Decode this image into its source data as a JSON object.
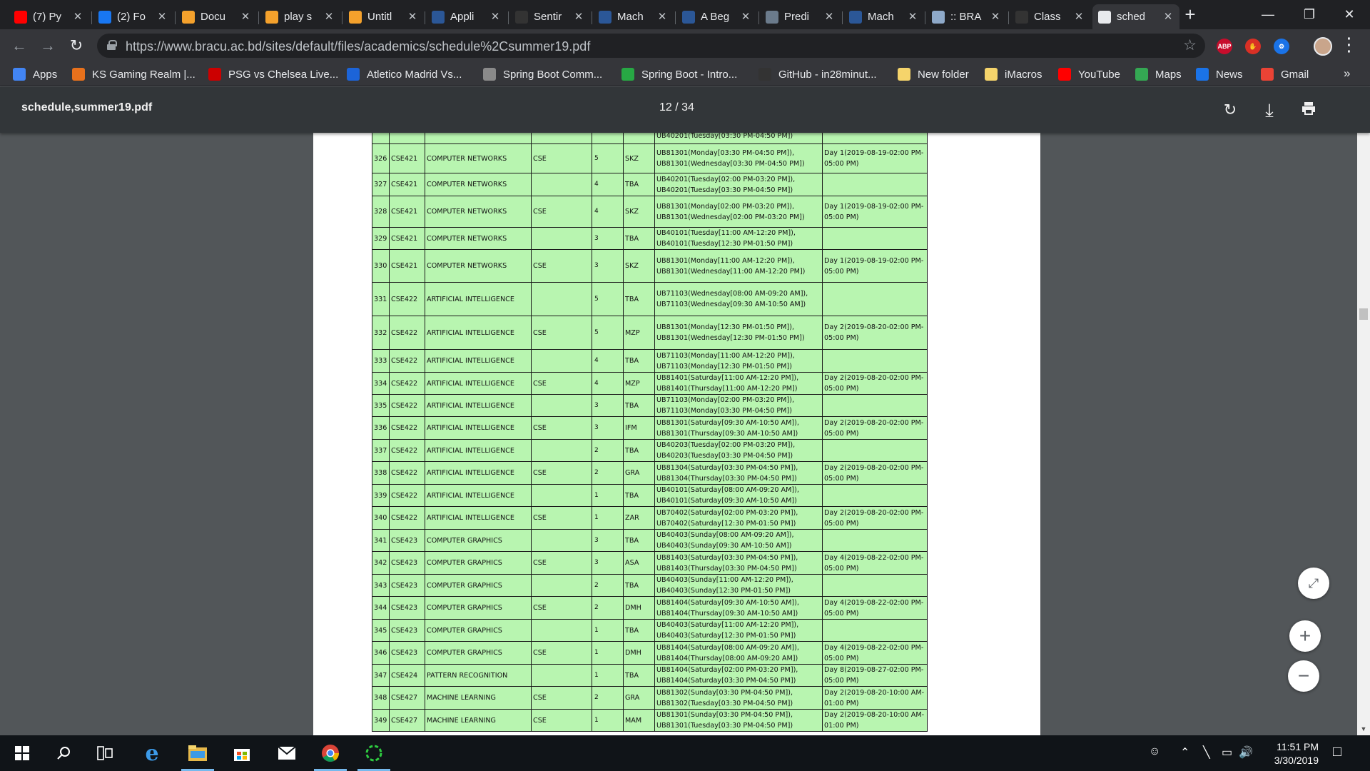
{
  "browser": {
    "tabs": [
      {
        "title": "(7) Py",
        "icon": "youtube-icon",
        "color": "#ff0000"
      },
      {
        "title": "(2) Fo",
        "icon": "facebook-icon",
        "color": "#1877f2"
      },
      {
        "title": "Docu",
        "icon": "docs-icon",
        "color": "#f4a12c"
      },
      {
        "title": "play s",
        "icon": "notebook-icon",
        "color": "#f4a12c"
      },
      {
        "title": "Untitl",
        "icon": "notebook-icon",
        "color": "#f4a12c"
      },
      {
        "title": "Appli",
        "icon": "page-icon",
        "color": "#2b5797"
      },
      {
        "title": "Sentir",
        "icon": "github-icon",
        "color": "#333333"
      },
      {
        "title": "Mach",
        "icon": "page-icon",
        "color": "#2b5797"
      },
      {
        "title": "A Beg",
        "icon": "page-icon",
        "color": "#2b5797"
      },
      {
        "title": "Predi",
        "icon": "image-icon",
        "color": "#6b7b8c"
      },
      {
        "title": "Mach",
        "icon": "page-icon",
        "color": "#2b5797"
      },
      {
        "title": ":: BRA",
        "icon": "bracu-icon",
        "color": "#8ea9c9"
      },
      {
        "title": "Class",
        "icon": "github-icon",
        "color": "#333333"
      },
      {
        "title": "sched",
        "icon": "document-icon",
        "color": "#e8eaed"
      }
    ],
    "url": "https://www.bracu.ac.bd/sites/default/files/academics/schedule%2Csummer19.pdf",
    "extensions": [
      {
        "label": "ABP",
        "icon": "adblock-icon",
        "color": "#c70d2c"
      },
      {
        "label": "✋",
        "icon": "hand-icon",
        "color": "#d93025"
      },
      {
        "label": "⚙",
        "icon": "settings-extension-icon",
        "color": "#1a73e8"
      }
    ],
    "bookmarks": [
      {
        "label": "Apps",
        "icon": "apps-grid-icon",
        "color": "#4285f4"
      },
      {
        "label": "KS Gaming Realm |...",
        "icon": "ks-gaming-icon",
        "color": "#e8711c"
      },
      {
        "label": "PSG vs Chelsea Live...",
        "icon": "ts-icon",
        "color": "#cc0000"
      },
      {
        "label": "Atletico Madrid Vs...",
        "icon": "soccer-icon",
        "color": "#1c64d8"
      },
      {
        "label": "Spring Boot Comm...",
        "icon": "spring-icon",
        "color": "#8a8a8a"
      },
      {
        "label": "Spring Boot - Intro...",
        "icon": "tutorial-icon",
        "color": "#27a844"
      },
      {
        "label": "GitHub - in28minut...",
        "icon": "github-icon",
        "color": "#333333"
      },
      {
        "label": "New folder",
        "icon": "folder-icon",
        "color": "#f5d46b"
      },
      {
        "label": "iMacros",
        "icon": "folder-icon",
        "color": "#f5d46b"
      },
      {
        "label": "YouTube",
        "icon": "youtube-icon",
        "color": "#ff0000"
      },
      {
        "label": "Maps",
        "icon": "maps-icon",
        "color": "#34a853"
      },
      {
        "label": "News",
        "icon": "news-icon",
        "color": "#1a73e8"
      },
      {
        "label": "Gmail",
        "icon": "gmail-icon",
        "color": "#ea4335"
      }
    ],
    "more_bookmarks": "»"
  },
  "pdf": {
    "filename": "schedule,summer19.pdf",
    "page_indicator": "12 / 34",
    "rows": [
      {
        "no": "",
        "code": "",
        "course": "",
        "dept": "",
        "sec": "",
        "faculty": "",
        "class_lines": [
          "",
          "UB40201(Tuesday[03:30 PM-04:50 PM])"
        ],
        "exam_lines": [
          ""
        ]
      },
      {
        "no": "326",
        "code": "CSE421",
        "course": "COMPUTER NETWORKS",
        "dept": "CSE",
        "sec": "5",
        "faculty": "SKZ",
        "class_lines": [
          "UB81301(Monday[03:30 PM-04:50 PM]),",
          "UB81301(Wednesday[03:30 PM-04:50 PM])"
        ],
        "exam_lines": [
          "Day 1(2019-08-19-02:00 PM-",
          "05:00 PM)"
        ]
      },
      {
        "no": "327",
        "code": "CSE421",
        "course": "COMPUTER NETWORKS",
        "dept": "",
        "sec": "4",
        "faculty": "TBA",
        "class_lines": [
          "UB40201(Tuesday[02:00 PM-03:20 PM]),",
          "UB40201(Tuesday[03:30 PM-04:50 PM])"
        ],
        "exam_lines": [
          ""
        ]
      },
      {
        "no": "328",
        "code": "CSE421",
        "course": "COMPUTER NETWORKS",
        "dept": "CSE",
        "sec": "4",
        "faculty": "SKZ",
        "class_lines": [
          "UB81301(Monday[02:00 PM-03:20 PM]),",
          "UB81301(Wednesday[02:00 PM-03:20 PM])"
        ],
        "exam_lines": [
          "Day 1(2019-08-19-02:00 PM-",
          "05:00 PM)"
        ]
      },
      {
        "no": "329",
        "code": "CSE421",
        "course": "COMPUTER NETWORKS",
        "dept": "",
        "sec": "3",
        "faculty": "TBA",
        "class_lines": [
          "UB40101(Tuesday[11:00 AM-12:20 PM]),",
          "UB40101(Tuesday[12:30 PM-01:50 PM])"
        ],
        "exam_lines": [
          ""
        ]
      },
      {
        "no": "330",
        "code": "CSE421",
        "course": "COMPUTER NETWORKS",
        "dept": "CSE",
        "sec": "3",
        "faculty": "SKZ",
        "class_lines": [
          "UB81301(Monday[11:00 AM-12:20 PM]),",
          "UB81301(Wednesday[11:00 AM-12:20 PM])"
        ],
        "exam_lines": [
          "Day 1(2019-08-19-02:00 PM-",
          "05:00 PM)"
        ]
      },
      {
        "no": "331",
        "code": "CSE422",
        "course": "ARTIFICIAL INTELLIGENCE",
        "dept": "",
        "sec": "5",
        "faculty": "TBA",
        "class_lines": [
          "UB71103(Wednesday[08:00 AM-09:20 AM]),",
          "UB71103(Wednesday[09:30 AM-10:50 AM])"
        ],
        "exam_lines": [
          ""
        ]
      },
      {
        "no": "332",
        "code": "CSE422",
        "course": "ARTIFICIAL INTELLIGENCE",
        "dept": "CSE",
        "sec": "5",
        "faculty": "MZP",
        "class_lines": [
          "UB81301(Monday[12:30 PM-01:50 PM]),",
          "UB81301(Wednesday[12:30 PM-01:50 PM])"
        ],
        "exam_lines": [
          "Day 2(2019-08-20-02:00 PM-",
          "05:00 PM)"
        ]
      },
      {
        "no": "333",
        "code": "CSE422",
        "course": "ARTIFICIAL INTELLIGENCE",
        "dept": "",
        "sec": "4",
        "faculty": "TBA",
        "class_lines": [
          "UB71103(Monday[11:00 AM-12:20 PM]),",
          "UB71103(Monday[12:30 PM-01:50 PM])"
        ],
        "exam_lines": [
          ""
        ]
      },
      {
        "no": "334",
        "code": "CSE422",
        "course": "ARTIFICIAL INTELLIGENCE",
        "dept": "CSE",
        "sec": "4",
        "faculty": "MZP",
        "class_lines": [
          "UB81401(Saturday[11:00 AM-12:20 PM]),",
          "UB81401(Thursday[11:00 AM-12:20 PM])"
        ],
        "exam_lines": [
          "Day 2(2019-08-20-02:00 PM-",
          "05:00 PM)"
        ]
      },
      {
        "no": "335",
        "code": "CSE422",
        "course": "ARTIFICIAL INTELLIGENCE",
        "dept": "",
        "sec": "3",
        "faculty": "TBA",
        "class_lines": [
          "UB71103(Monday[02:00 PM-03:20 PM]),",
          "UB71103(Monday[03:30 PM-04:50 PM])"
        ],
        "exam_lines": [
          ""
        ]
      },
      {
        "no": "336",
        "code": "CSE422",
        "course": "ARTIFICIAL INTELLIGENCE",
        "dept": "CSE",
        "sec": "3",
        "faculty": "IFM",
        "class_lines": [
          "UB81301(Saturday[09:30 AM-10:50 AM]),",
          "UB81301(Thursday[09:30 AM-10:50 AM])"
        ],
        "exam_lines": [
          "Day 2(2019-08-20-02:00 PM-",
          "05:00 PM)"
        ]
      },
      {
        "no": "337",
        "code": "CSE422",
        "course": "ARTIFICIAL INTELLIGENCE",
        "dept": "",
        "sec": "2",
        "faculty": "TBA",
        "class_lines": [
          "UB40203(Tuesday[02:00 PM-03:20 PM]),",
          "UB40203(Tuesday[03:30 PM-04:50 PM])"
        ],
        "exam_lines": [
          ""
        ]
      },
      {
        "no": "338",
        "code": "CSE422",
        "course": "ARTIFICIAL INTELLIGENCE",
        "dept": "CSE",
        "sec": "2",
        "faculty": "GRA",
        "class_lines": [
          "UB81304(Saturday[03:30 PM-04:50 PM]),",
          "UB81304(Thursday[03:30 PM-04:50 PM])"
        ],
        "exam_lines": [
          "Day 2(2019-08-20-02:00 PM-",
          "05:00 PM)"
        ]
      },
      {
        "no": "339",
        "code": "CSE422",
        "course": "ARTIFICIAL INTELLIGENCE",
        "dept": "",
        "sec": "1",
        "faculty": "TBA",
        "class_lines": [
          "UB40101(Saturday[08:00 AM-09:20 AM]),",
          "UB40101(Saturday[09:30 AM-10:50 AM])"
        ],
        "exam_lines": [
          ""
        ]
      },
      {
        "no": "340",
        "code": "CSE422",
        "course": "ARTIFICIAL INTELLIGENCE",
        "dept": "CSE",
        "sec": "1",
        "faculty": "ZAR",
        "class_lines": [
          "UB70402(Saturday[02:00 PM-03:20 PM]),",
          "UB70402(Saturday[12:30 PM-01:50 PM])"
        ],
        "exam_lines": [
          "Day 2(2019-08-20-02:00 PM-",
          "05:00 PM)"
        ]
      },
      {
        "no": "341",
        "code": "CSE423",
        "course": "COMPUTER GRAPHICS",
        "dept": "",
        "sec": "3",
        "faculty": "TBA",
        "class_lines": [
          "UB40403(Sunday[08:00 AM-09:20 AM]),",
          "UB40403(Sunday[09:30 AM-10:50 AM])"
        ],
        "exam_lines": [
          ""
        ]
      },
      {
        "no": "342",
        "code": "CSE423",
        "course": "COMPUTER GRAPHICS",
        "dept": "CSE",
        "sec": "3",
        "faculty": "ASA",
        "class_lines": [
          "UB81403(Saturday[03:30 PM-04:50 PM]),",
          "UB81403(Thursday[03:30 PM-04:50 PM])"
        ],
        "exam_lines": [
          "Day 4(2019-08-22-02:00 PM-",
          "05:00 PM)"
        ]
      },
      {
        "no": "343",
        "code": "CSE423",
        "course": "COMPUTER GRAPHICS",
        "dept": "",
        "sec": "2",
        "faculty": "TBA",
        "class_lines": [
          "UB40403(Sunday[11:00 AM-12:20 PM]),",
          "UB40403(Sunday[12:30 PM-01:50 PM])"
        ],
        "exam_lines": [
          ""
        ]
      },
      {
        "no": "344",
        "code": "CSE423",
        "course": "COMPUTER GRAPHICS",
        "dept": "CSE",
        "sec": "2",
        "faculty": "DMH",
        "class_lines": [
          "UB81404(Saturday[09:30 AM-10:50 AM]),",
          "UB81404(Thursday[09:30 AM-10:50 AM])"
        ],
        "exam_lines": [
          "Day 4(2019-08-22-02:00 PM-",
          "05:00 PM)"
        ]
      },
      {
        "no": "345",
        "code": "CSE423",
        "course": "COMPUTER GRAPHICS",
        "dept": "",
        "sec": "1",
        "faculty": "TBA",
        "class_lines": [
          "UB40403(Saturday[11:00 AM-12:20 PM]),",
          "UB40403(Saturday[12:30 PM-01:50 PM])"
        ],
        "exam_lines": [
          ""
        ]
      },
      {
        "no": "346",
        "code": "CSE423",
        "course": "COMPUTER GRAPHICS",
        "dept": "CSE",
        "sec": "1",
        "faculty": "DMH",
        "class_lines": [
          "UB81404(Saturday[08:00 AM-09:20 AM]),",
          "UB81404(Thursday[08:00 AM-09:20 AM])"
        ],
        "exam_lines": [
          "Day 4(2019-08-22-02:00 PM-",
          "05:00 PM)"
        ]
      },
      {
        "no": "347",
        "code": "CSE424",
        "course": "PATTERN RECOGNITION",
        "dept": "",
        "sec": "1",
        "faculty": "TBA",
        "class_lines": [
          "UB81404(Saturday[02:00 PM-03:20 PM]),",
          "UB81404(Saturday[03:30 PM-04:50 PM])"
        ],
        "exam_lines": [
          "Day 8(2019-08-27-02:00 PM-",
          "05:00 PM)"
        ]
      },
      {
        "no": "348",
        "code": "CSE427",
        "course": "MACHINE LEARNING",
        "dept": "CSE",
        "sec": "2",
        "faculty": "GRA",
        "class_lines": [
          "UB81302(Sunday[03:30 PM-04:50 PM]),",
          "UB81302(Tuesday[03:30 PM-04:50 PM])"
        ],
        "exam_lines": [
          "Day 2(2019-08-20-10:00 AM-",
          "01:00 PM)"
        ]
      },
      {
        "no": "349",
        "code": "CSE427",
        "course": "MACHINE LEARNING",
        "dept": "CSE",
        "sec": "1",
        "faculty": "MAM",
        "class_lines": [
          "UB81301(Sunday[03:30 PM-04:50 PM]),",
          "UB81301(Tuesday[03:30 PM-04:50 PM])"
        ],
        "exam_lines": [
          "Day 2(2019-08-20-10:00 AM-",
          "01:00 PM)"
        ]
      }
    ],
    "row_color": "#b8f5b0"
  },
  "taskbar": {
    "apps": [
      {
        "icon": "windows-start-icon",
        "running": false
      },
      {
        "icon": "search-icon",
        "running": false
      },
      {
        "icon": "task-view-icon",
        "running": false
      },
      {
        "icon": "edge-icon",
        "running": false
      },
      {
        "icon": "file-explorer-icon",
        "running": true
      },
      {
        "icon": "store-icon",
        "running": false
      },
      {
        "icon": "mail-icon",
        "running": false
      },
      {
        "icon": "chrome-icon",
        "running": true
      },
      {
        "icon": "loader-app-icon",
        "running": true
      }
    ],
    "time": "11:51 PM",
    "date": "3/30/2019"
  }
}
